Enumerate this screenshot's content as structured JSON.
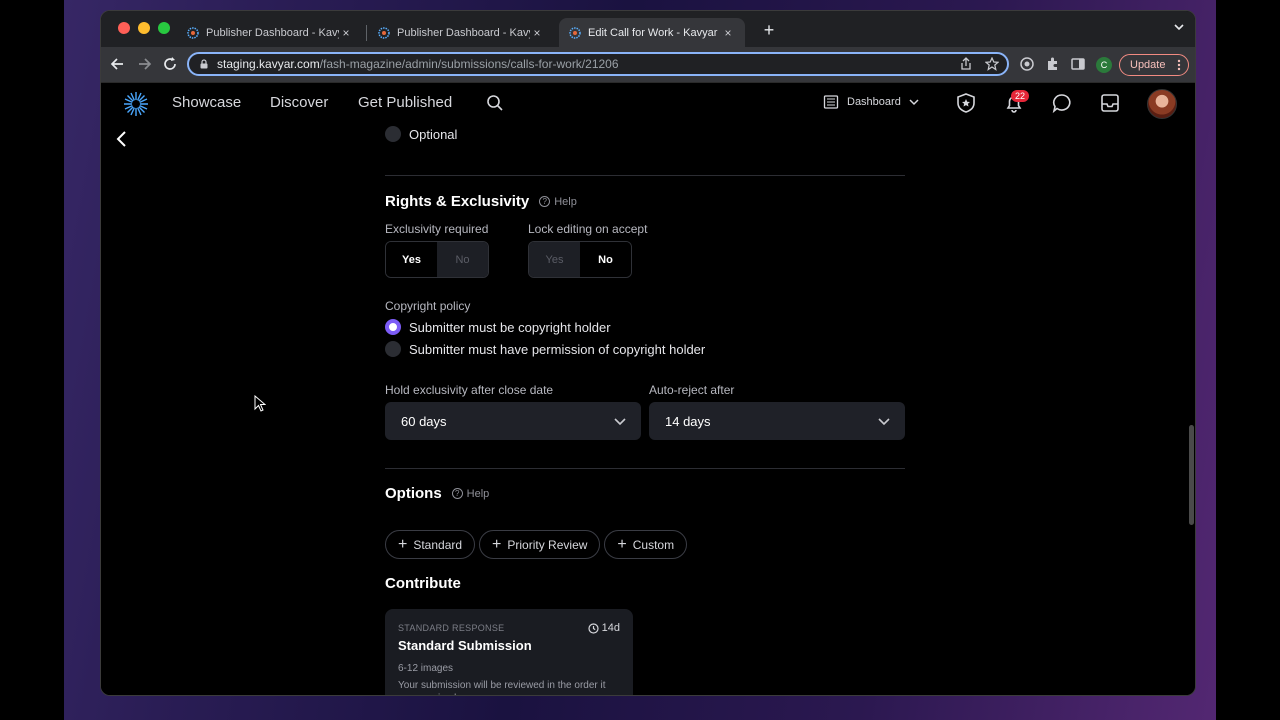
{
  "browser": {
    "tabs": [
      {
        "title": "Publisher Dashboard - Kavyar",
        "close": "×"
      },
      {
        "title": "Publisher Dashboard - Kavyar",
        "close": "×"
      },
      {
        "title": "Edit Call for Work - Kavyar",
        "close": "×"
      }
    ],
    "new_tab": "+",
    "url_host": "staging.kavyar.com",
    "url_path": "/fash-magazine/admin/submissions/calls-for-work/21206",
    "profile_initial": "C",
    "update_label": "Update"
  },
  "app": {
    "nav": {
      "showcase": "Showcase",
      "discover": "Discover",
      "get_published": "Get Published"
    },
    "dashboard_label": "Dashboard",
    "notification_count": "22"
  },
  "form": {
    "optional_label": "Optional",
    "rights": {
      "title": "Rights & Exclusivity",
      "help": "Help",
      "exclusivity_label": "Exclusivity required",
      "exclusivity_yes": "Yes",
      "exclusivity_no": "No",
      "lock_label": "Lock editing on accept",
      "lock_yes": "Yes",
      "lock_no": "No",
      "copyright_label": "Copyright policy",
      "copyright_opt1": "Submitter must be copyright holder",
      "copyright_opt2": "Submitter must have permission of copyright holder",
      "hold_label": "Hold exclusivity after close date",
      "hold_value": "60 days",
      "autoreject_label": "Auto-reject after",
      "autoreject_value": "14 days"
    },
    "options": {
      "title": "Options",
      "help": "Help",
      "standard": "Standard",
      "priority": "Priority Review",
      "custom": "Custom"
    },
    "contribute": {
      "title": "Contribute",
      "card": {
        "kicker": "STANDARD RESPONSE",
        "duration": "14d",
        "title": "Standard Submission",
        "meta": "6-12 images",
        "desc": "Your submission will be reviewed in the order it was received."
      }
    }
  },
  "colors": {
    "accent": "#7c5cf6",
    "badge": "#e62638",
    "omnibox_focus": "#8ab4f8"
  }
}
